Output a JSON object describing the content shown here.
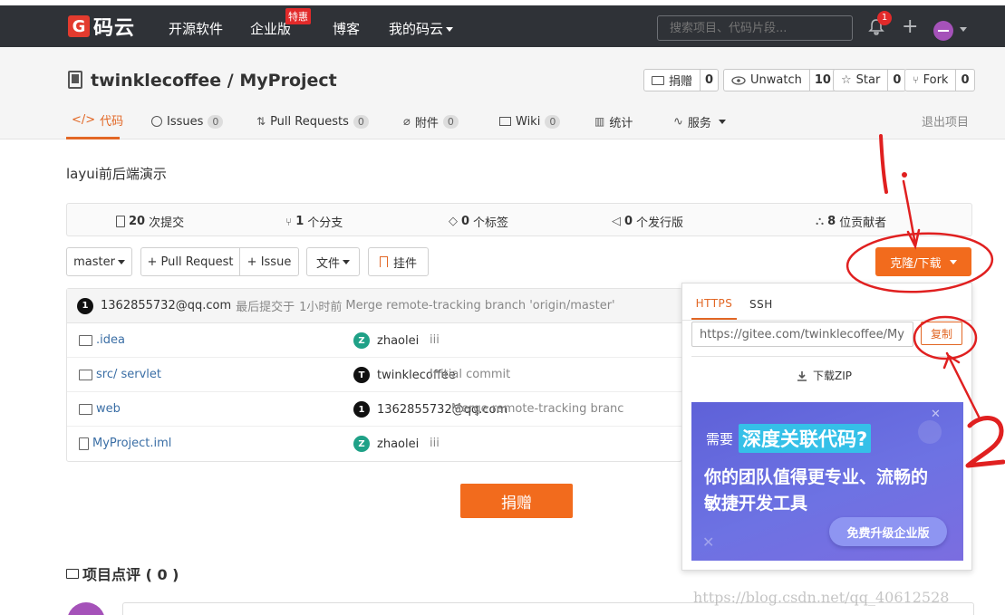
{
  "nav": {
    "logo": "码云",
    "links": [
      "开源软件",
      "企业版",
      "博客",
      "我的码云"
    ],
    "hot_badge": "特惠",
    "search_placeholder": "搜索项目、代码片段...",
    "notification_count": "1"
  },
  "project": {
    "title": "twinklecoffee / MyProject",
    "donate_label": "捐赠",
    "donate_count": "0",
    "watch_label": "Unwatch",
    "watch_count": "10",
    "star_label": "Star",
    "star_count": "0",
    "fork_label": "Fork",
    "fork_count": "0",
    "exit_label": "退出项目"
  },
  "tabs": [
    {
      "label": "代码"
    },
    {
      "label": "Issues",
      "count": "0"
    },
    {
      "label": "Pull Requests",
      "count": "0"
    },
    {
      "label": "附件",
      "count": "0"
    },
    {
      "label": "Wiki",
      "count": "0"
    },
    {
      "label": "统计"
    },
    {
      "label": "服务"
    }
  ],
  "description": "layui前后端演示",
  "stats": {
    "commits_n": "20",
    "commits_label": "次提交",
    "branches_n": "1",
    "branches_label": "个分支",
    "tags_n": "0",
    "tags_label": "个标签",
    "releases_n": "0",
    "releases_label": "个发行版",
    "contrib_n": "8",
    "contrib_label": "位贡献者"
  },
  "toolbar": {
    "branch": "master",
    "pull_request": "+ Pull Request",
    "issue": "+ Issue",
    "file": "文件",
    "widget": "挂件",
    "clone": "克隆/下载"
  },
  "latest_commit": {
    "avatar": "1",
    "author": "1362855732@qq.com",
    "text": "最后提交于",
    "time": "1小时前",
    "message": "Merge remote-tracking branch 'origin/master'"
  },
  "files": [
    {
      "name": ".idea",
      "avatar": "Z",
      "author": "zhaolei",
      "message": "iii"
    },
    {
      "name": "src/ servlet",
      "avatar": "T",
      "author": "twinklecoffee",
      "message": "Initial commit"
    },
    {
      "name": "web",
      "avatar": "1",
      "author": "1362855732@qq.com",
      "message": "Merge remote-tracking branc"
    },
    {
      "name": "MyProject.iml",
      "avatar": "Z",
      "author": "zhaolei",
      "message": "iii"
    }
  ],
  "donate_button": "捐赠",
  "review": {
    "title": "项目点评 ( 0 )"
  },
  "clone_panel": {
    "tab_https": "HTTPS",
    "tab_ssh": "SSH",
    "url": "https://gitee.com/twinklecoffee/MyProject.git",
    "copy": "复制",
    "download_zip": "下载ZIP",
    "promo_prefix": "需要",
    "promo_highlight": "深度关联代码?",
    "promo_line2": "你的团队值得更专业、流畅的",
    "promo_line3": "敏捷开发工具",
    "promo_button": "免费升级企业版"
  },
  "annotations": {
    "step1": "1.",
    "step2": "2"
  },
  "watermark": "https://blog.csdn.net/qq_40612528",
  "colors": {
    "accent": "#f26b1d",
    "nav_bg": "#2f3237",
    "annotation": "#e02020"
  }
}
